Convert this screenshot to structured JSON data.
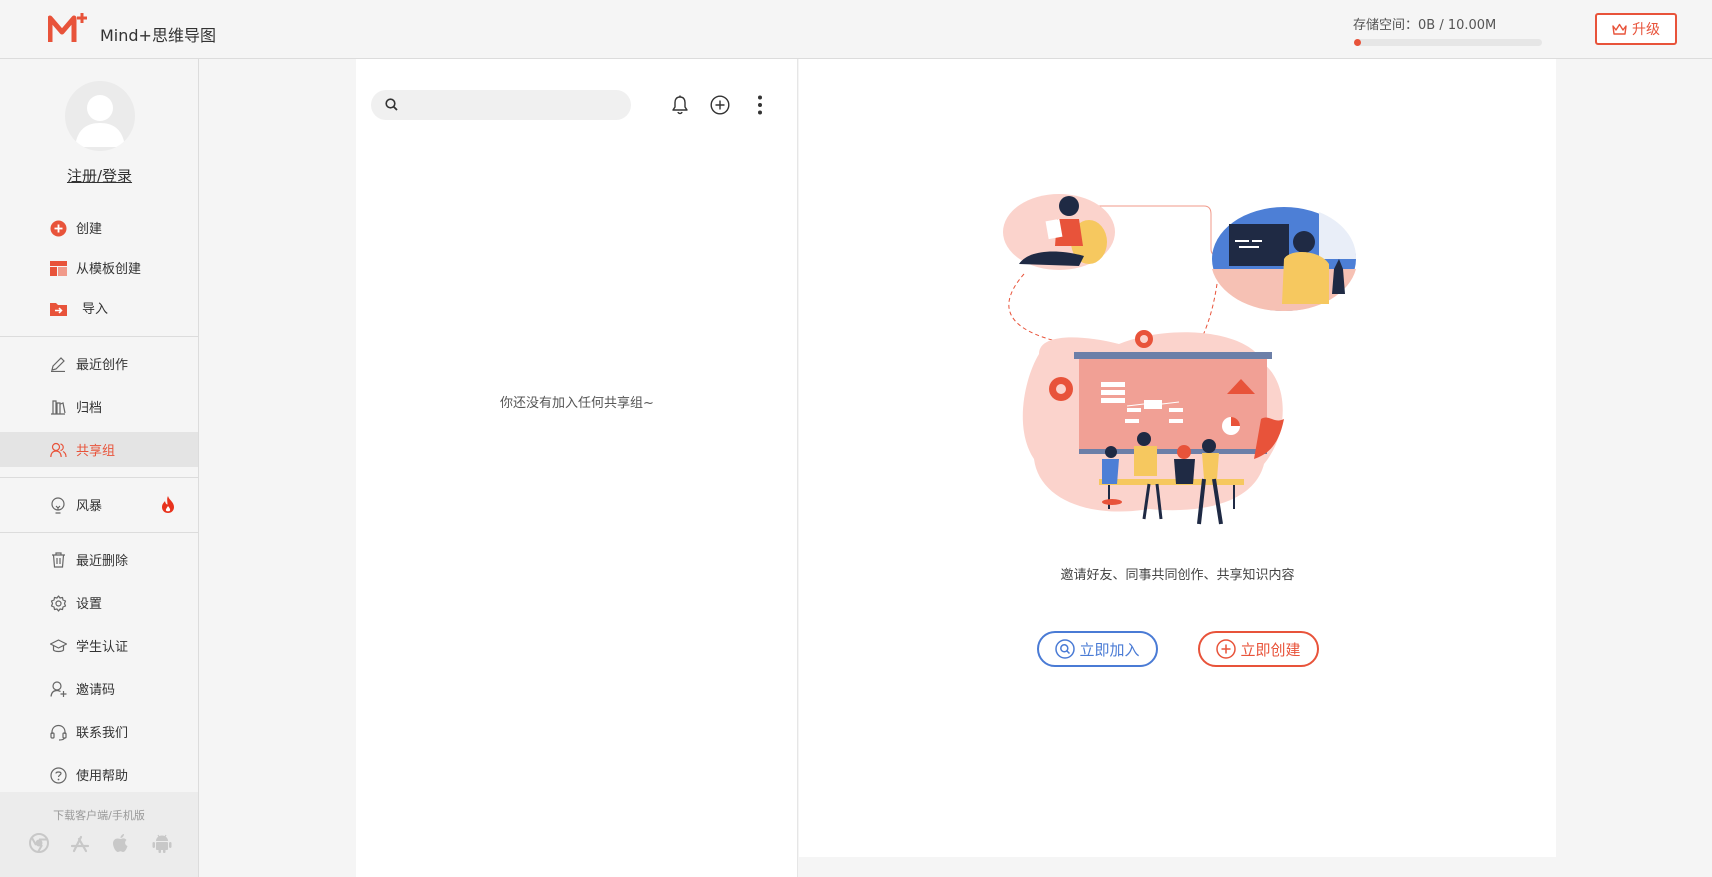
{
  "header": {
    "app_title": "Mind+思维导图",
    "logo_icon": "mind-plus-logo",
    "storage_text": "存储空间：0B / 10.00M",
    "storage_used_fraction": 0.0,
    "upgrade_label": "升级"
  },
  "sidebar": {
    "login_label": "注册/登录",
    "create_items": [
      {
        "label": "创建",
        "icon": "plus-circle-icon"
      },
      {
        "label": "从模板创建",
        "icon": "template-icon"
      },
      {
        "label": "导入",
        "icon": "import-folder-icon"
      }
    ],
    "nav_items": [
      {
        "label": "最近创作",
        "icon": "pencil-icon"
      },
      {
        "label": "归档",
        "icon": "archive-icon"
      },
      {
        "label": "共享组",
        "icon": "users-icon",
        "active": true
      }
    ],
    "storm_item": {
      "label": "风暴",
      "icon": "bulb-icon",
      "badge_icon": "fire-icon"
    },
    "bottom_items": [
      {
        "label": "最近删除",
        "icon": "trash-icon"
      },
      {
        "label": "设置",
        "icon": "gear-icon"
      },
      {
        "label": "学生认证",
        "icon": "graduation-cap-icon"
      },
      {
        "label": "邀请码",
        "icon": "user-plus-icon"
      },
      {
        "label": "联系我们",
        "icon": "headset-icon"
      },
      {
        "label": "使用帮助",
        "icon": "help-circle-icon"
      }
    ],
    "download_label": "下载客户端/手机版",
    "platform_icons": [
      "chrome-icon",
      "app-store-icon",
      "apple-icon",
      "android-icon"
    ]
  },
  "list_panel": {
    "search_placeholder": "",
    "empty_text": "你还没有加入任何共享组~"
  },
  "detail_panel": {
    "invite_text": "邀请好友、同事共同创作、共享知识内容",
    "join_label": "立即加入",
    "create_label": "立即创建"
  },
  "colors": {
    "accent": "#e8533a",
    "join_blue": "#4a7bd5",
    "background": "#f5f5f5"
  }
}
